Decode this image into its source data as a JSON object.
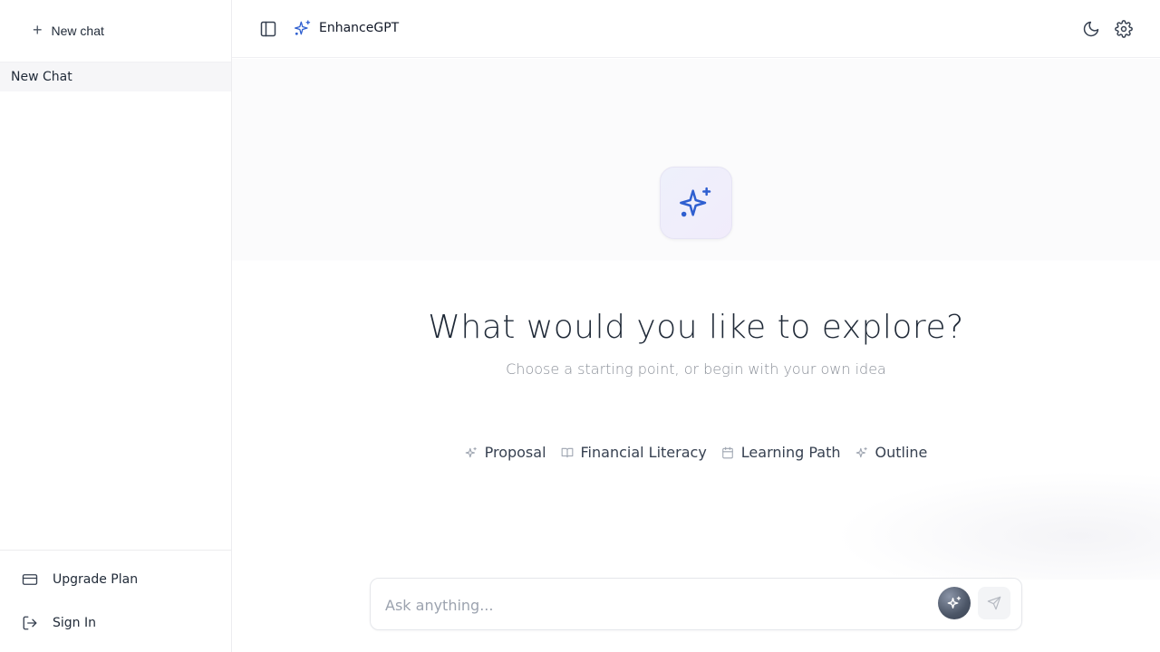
{
  "app": {
    "name": "EnhanceGPT"
  },
  "sidebar": {
    "new_chat_label": "New chat",
    "chats": [
      {
        "title": "New Chat",
        "active": true
      }
    ],
    "upgrade_label": "Upgrade Plan",
    "sign_in_label": "Sign In"
  },
  "header": {
    "brand": "EnhanceGPT",
    "icons": [
      "sidebar-toggle-icon",
      "sparkle-icon",
      "moon-icon",
      "gear-icon"
    ]
  },
  "hero": {
    "title": "What would you like to explore?",
    "subtitle": "Choose a starting point, or begin with your own idea",
    "icon": "sparkle-icon"
  },
  "suggestions": [
    {
      "label": "Proposal",
      "icon": "sparkle-icon"
    },
    {
      "label": "Financial Literacy",
      "icon": "book-icon"
    },
    {
      "label": "Learning Path",
      "icon": "calendar-icon"
    },
    {
      "label": "Outline",
      "icon": "sparkle-icon"
    }
  ],
  "composer": {
    "placeholder": "Ask anything...",
    "value": ""
  },
  "colors": {
    "accent": "#2f5fd0",
    "text": "#1f2937",
    "muted": "#8a8f98"
  }
}
